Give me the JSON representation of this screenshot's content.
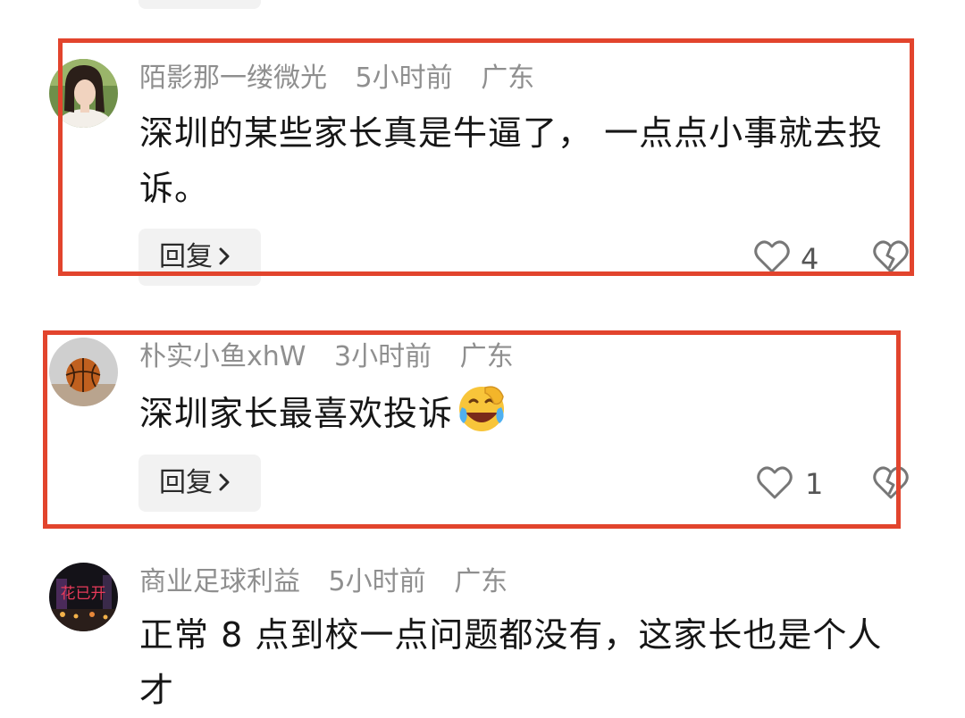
{
  "comments": [
    {
      "username": "陌影那一缕微光",
      "time": "5小时前",
      "location": "广东",
      "text": "深圳的某些家长真是牛逼了， 一点点小事就去投诉。",
      "reply_label": "回复",
      "likes": "4"
    },
    {
      "username": "朴实小鱼xhW",
      "time": "3小时前",
      "location": "广东",
      "text": "深圳家长最喜欢投诉",
      "emoji": "laughing-crying-emoji",
      "reply_label": "回复",
      "likes": "1"
    },
    {
      "username": "商业足球利益",
      "time": "5小时前",
      "location": "广东",
      "text": "正常 8 点到校一点问题都没有，这家长也是个人才"
    }
  ],
  "colors": {
    "highlight": "#e2442d",
    "meta": "#8f8f8f",
    "text": "#161616",
    "button_bg": "#f2f2f2"
  }
}
